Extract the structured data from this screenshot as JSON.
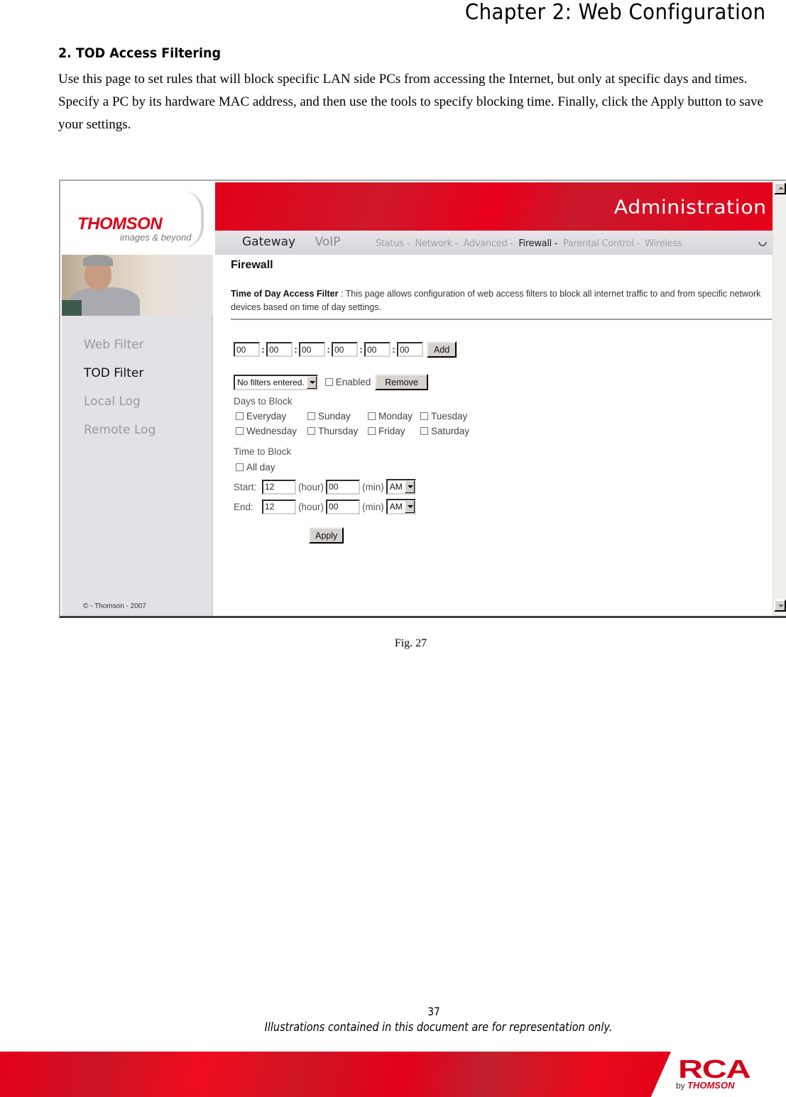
{
  "document": {
    "chapter_title": "Chapter 2: Web Configuration",
    "section_title": "2. TOD Access Filtering",
    "intro": "Use this page to set rules that will block specific LAN side PCs from accessing the Internet, but only at specific days and times. Specify a PC by its hardware MAC address, and then use the tools to specify blocking time. Finally, click the Apply button to save your settings.",
    "figure_caption": "Fig. 27",
    "page_number": "37",
    "disclaimer": "Illustrations contained in this document are for representation only.",
    "footer_logo": "RCA",
    "footer_logo_sub_prefix": "by",
    "footer_logo_sub_brand": "THOMSON",
    "brand_color": "#e00019"
  },
  "app": {
    "logo": "THOMSON",
    "logo_tagline": "images & beyond",
    "banner_title": "Administration",
    "main_tabs": [
      {
        "label": "Gateway",
        "active": true
      },
      {
        "label": "VoIP",
        "active": false
      }
    ],
    "sub_nav": [
      {
        "label": "Status -",
        "active": false
      },
      {
        "label": "Network -",
        "active": false
      },
      {
        "label": "Advanced -",
        "active": false
      },
      {
        "label": "Firewall -",
        "active": true
      },
      {
        "label": "Parental Control -",
        "active": false
      },
      {
        "label": "Wireless",
        "active": false
      }
    ],
    "sidebar": {
      "items": [
        {
          "label": "Web Filter",
          "active": false
        },
        {
          "label": "TOD Filter",
          "active": true
        },
        {
          "label": "Local Log",
          "active": false
        },
        {
          "label": "Remote Log",
          "active": false
        }
      ],
      "copyright": "© - Thomson - 2007"
    },
    "content": {
      "title": "Firewall",
      "desc_label": "Time of Day Access Filter",
      "desc_sep": " : ",
      "desc_text": " This page allows configuration of web access filters to block all internet traffic to and from specific network devices based on time of day settings.",
      "mac_fields": [
        "00",
        "00",
        "00",
        "00",
        "00",
        "00"
      ],
      "mac_separator": ":",
      "add_label": "Add",
      "filter_select": "No filters entered.",
      "enabled_label": "Enabled",
      "enabled_checked": false,
      "remove_label": "Remove",
      "days_label": "Days to Block",
      "days": [
        {
          "label": "Everyday",
          "checked": false
        },
        {
          "label": "Sunday",
          "checked": false
        },
        {
          "label": "Monday",
          "checked": false
        },
        {
          "label": "Tuesday",
          "checked": false
        },
        {
          "label": "Wednesday",
          "checked": false
        },
        {
          "label": "Thursday",
          "checked": false
        },
        {
          "label": "Friday",
          "checked": false
        },
        {
          "label": "Saturday",
          "checked": false
        }
      ],
      "time_label": "Time to Block",
      "all_day_label": "All day",
      "all_day_checked": false,
      "start": {
        "label": "Start:",
        "hour": "12",
        "hour_unit": "(hour)",
        "min": "00",
        "min_unit": "(min)",
        "ampm": "AM"
      },
      "end": {
        "label": "End:",
        "hour": "12",
        "hour_unit": "(hour)",
        "min": "00",
        "min_unit": "(min)",
        "ampm": "AM"
      },
      "apply_label": "Apply"
    }
  }
}
